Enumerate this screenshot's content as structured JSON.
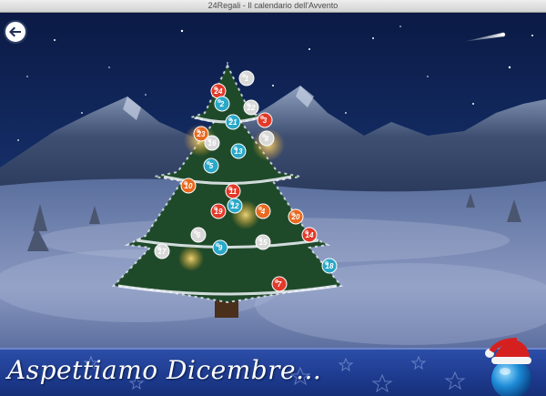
{
  "window": {
    "title": "24Regali - Il calendario dell'Avvento"
  },
  "banner": {
    "text": "Aspettiamo Dicembre..."
  },
  "icons": {
    "back": "back-arrow-icon",
    "santa": "santa-hat-ball-icon"
  },
  "colors": {
    "sky_top": "#0b1a45",
    "banner": "#1d3a8e",
    "snow": "#ffffff"
  },
  "ornaments": [
    {
      "label": "1",
      "color": "#d8d8d8"
    },
    {
      "label": "24",
      "color": "#e23a2a"
    },
    {
      "label": "2",
      "color": "#2aa8c8"
    },
    {
      "label": "22",
      "color": "#d8d8d8"
    },
    {
      "label": "21",
      "color": "#2aa8c8"
    },
    {
      "label": "3",
      "color": "#e23a2a"
    },
    {
      "label": "23",
      "color": "#e86a20"
    },
    {
      "label": "16",
      "color": "#d8d8d8"
    },
    {
      "label": "13",
      "color": "#2aa8c8"
    },
    {
      "label": "8",
      "color": "#d8d8d8"
    },
    {
      "label": "5",
      "color": "#2aa8c8"
    },
    {
      "label": "10",
      "color": "#e86a20"
    },
    {
      "label": "11",
      "color": "#e23a2a"
    },
    {
      "label": "4",
      "color": "#e86a20"
    },
    {
      "label": "12",
      "color": "#2aa8c8"
    },
    {
      "label": "19",
      "color": "#e23a2a"
    },
    {
      "label": "6",
      "color": "#d8d8d8"
    },
    {
      "label": "20",
      "color": "#e86a20"
    },
    {
      "label": "17",
      "color": "#d8d8d8"
    },
    {
      "label": "9",
      "color": "#2aa8c8"
    },
    {
      "label": "15",
      "color": "#d8d8d8"
    },
    {
      "label": "14",
      "color": "#e23a2a"
    },
    {
      "label": "18",
      "color": "#2aa8c8"
    },
    {
      "label": "7",
      "color": "#e23a2a"
    }
  ]
}
